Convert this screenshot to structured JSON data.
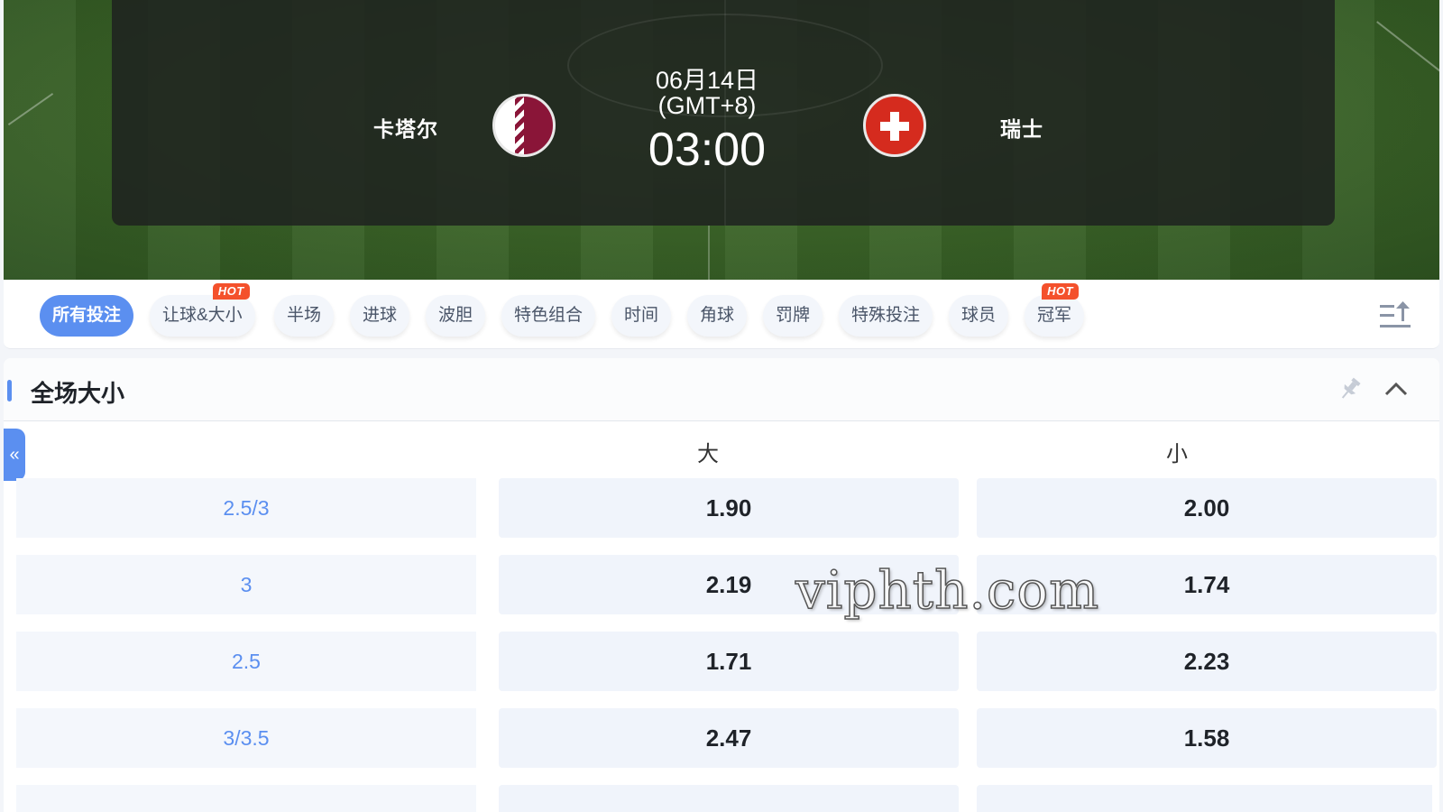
{
  "match": {
    "home_team": "卡塔尔",
    "away_team": "瑞士",
    "date": "06月14日",
    "timezone": "(GMT+8)",
    "kickoff_time": "03:00",
    "home_flag_icon": "qatar-flag-icon",
    "away_flag_icon": "switzerland-flag-icon"
  },
  "tabs": [
    {
      "label": "所有投注",
      "active": true,
      "hot": false
    },
    {
      "label": "让球&大小",
      "active": false,
      "hot": true
    },
    {
      "label": "半场",
      "active": false,
      "hot": false
    },
    {
      "label": "进球",
      "active": false,
      "hot": false
    },
    {
      "label": "波胆",
      "active": false,
      "hot": false
    },
    {
      "label": "特色组合",
      "active": false,
      "hot": false
    },
    {
      "label": "时间",
      "active": false,
      "hot": false
    },
    {
      "label": "角球",
      "active": false,
      "hot": false
    },
    {
      "label": "罚牌",
      "active": false,
      "hot": false
    },
    {
      "label": "特殊投注",
      "active": false,
      "hot": false
    },
    {
      "label": "球员",
      "active": false,
      "hot": false
    },
    {
      "label": "冠军",
      "active": false,
      "hot": true
    }
  ],
  "hot_label": "HOT",
  "market": {
    "title": "全场大小",
    "side_toggle": "«",
    "columns": {
      "over": "大",
      "under": "小"
    },
    "rows": [
      {
        "line": "2.5/3",
        "over": "1.90",
        "under": "2.00"
      },
      {
        "line": "3",
        "over": "2.19",
        "under": "1.74"
      },
      {
        "line": "2.5",
        "over": "1.71",
        "under": "2.23"
      },
      {
        "line": "3/3.5",
        "over": "2.47",
        "under": "1.58"
      }
    ]
  },
  "watermark": "viphth.com",
  "colors": {
    "accent": "#5b8ff0",
    "hot": "#f4512c",
    "odds_bg": "#f0f4fb"
  }
}
